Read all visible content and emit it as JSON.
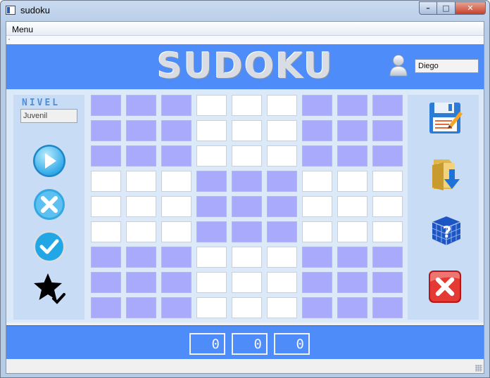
{
  "window": {
    "title": "sudoku",
    "minimize": "–",
    "maximize": "□",
    "close": "✕"
  },
  "menu": {
    "items": [
      "Menu"
    ]
  },
  "header": {
    "logo": "SUDOKU",
    "username": "Diego",
    "user_icon": "user-avatar-icon"
  },
  "left_panel": {
    "level_label": "NIVEL",
    "level_value": "Juvenil",
    "buttons": [
      {
        "name": "play-button",
        "icon": "play-icon"
      },
      {
        "name": "clear-button",
        "icon": "x-icon"
      },
      {
        "name": "check-button",
        "icon": "checkmark-icon"
      },
      {
        "name": "rating-button",
        "icon": "star-check-icon"
      }
    ]
  },
  "board": {
    "rows": 9,
    "cols": 9,
    "values": [
      [
        "",
        "",
        "",
        "",
        "",
        "",
        "",
        "",
        ""
      ],
      [
        "",
        "",
        "",
        "",
        "",
        "",
        "",
        "",
        ""
      ],
      [
        "",
        "",
        "",
        "",
        "",
        "",
        "",
        "",
        ""
      ],
      [
        "",
        "",
        "",
        "",
        "",
        "",
        "",
        "",
        ""
      ],
      [
        "",
        "",
        "",
        "",
        "",
        "",
        "",
        "",
        ""
      ],
      [
        "",
        "",
        "",
        "",
        "",
        "",
        "",
        "",
        ""
      ],
      [
        "",
        "",
        "",
        "",
        "",
        "",
        "",
        "",
        ""
      ],
      [
        "",
        "",
        "",
        "",
        "",
        "",
        "",
        "",
        ""
      ],
      [
        "",
        "",
        "",
        "",
        "",
        "",
        "",
        "",
        ""
      ]
    ]
  },
  "right_panel": {
    "buttons": [
      {
        "name": "save-button",
        "icon": "floppy-disk-icon"
      },
      {
        "name": "load-button",
        "icon": "folder-download-icon"
      },
      {
        "name": "help-button",
        "icon": "sudoku-cube-help-icon"
      },
      {
        "name": "exit-button",
        "icon": "red-x-icon"
      }
    ]
  },
  "timer": {
    "hours": "0",
    "minutes": "0",
    "seconds": "0"
  },
  "colors": {
    "accent": "#4d8cf9",
    "shaded_cell": "#aaaafc",
    "panel": "#c8dcf6"
  }
}
